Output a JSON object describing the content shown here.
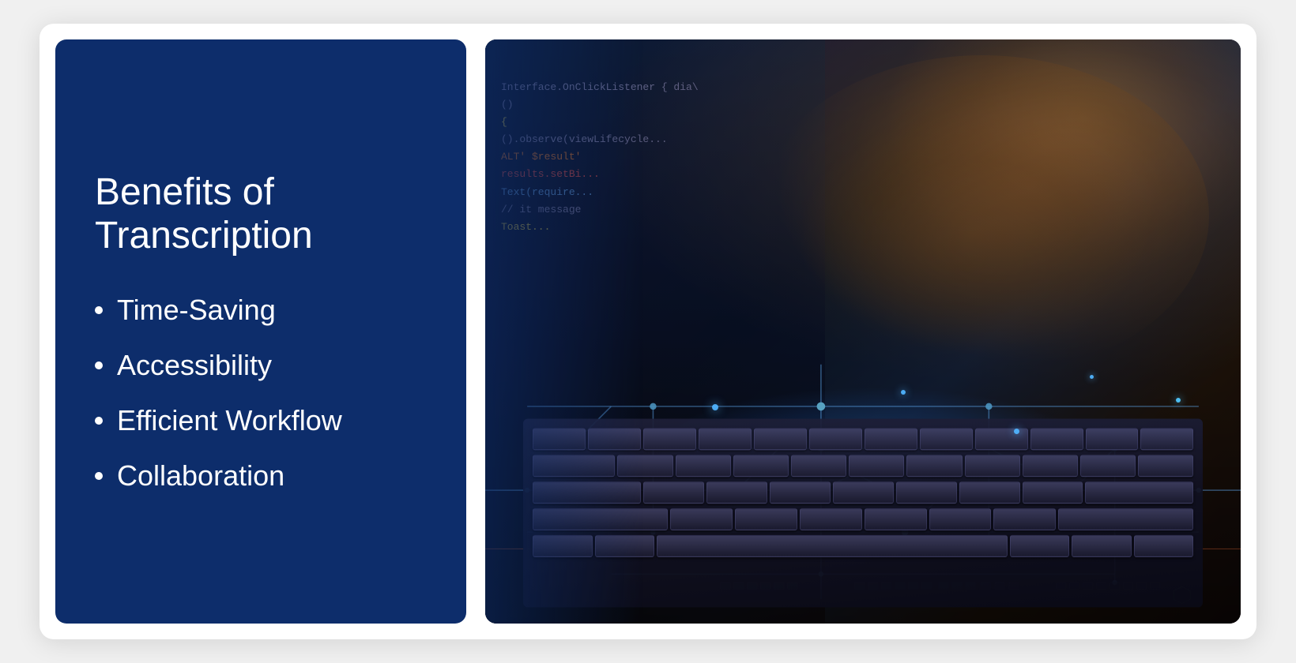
{
  "slide": {
    "left_panel": {
      "title_line1": "Benefits of",
      "title_line2": "Transcription",
      "bullets": [
        {
          "id": "bullet-time-saving",
          "label": "Time-Saving"
        },
        {
          "id": "bullet-accessibility",
          "label": "Accessibility"
        },
        {
          "id": "bullet-efficient-workflow",
          "label": "Efficient Workflow"
        },
        {
          "id": "bullet-collaboration",
          "label": "Collaboration"
        }
      ]
    },
    "right_panel": {
      "image_alt": "Person typing on keyboard with technology circuit overlay"
    },
    "colors": {
      "left_bg": "#0d2d6b",
      "text_white": "#ffffff",
      "slide_bg": "#ffffff"
    },
    "code_lines": [
      {
        "text": "Interface.OnClickListener { dia\\",
        "style": "gray"
      },
      {
        "text": "()",
        "style": "gray"
      },
      {
        "text": "",
        "style": ""
      },
      {
        "text": "().observe(viewLifecycle",
        "style": "yellow"
      },
      {
        "text": "ALT'  $result'",
        "style": "orange"
      },
      {
        "text": "results.setBi",
        "style": "red"
      },
      {
        "text": "Text(require",
        "style": "blue"
      }
    ]
  }
}
